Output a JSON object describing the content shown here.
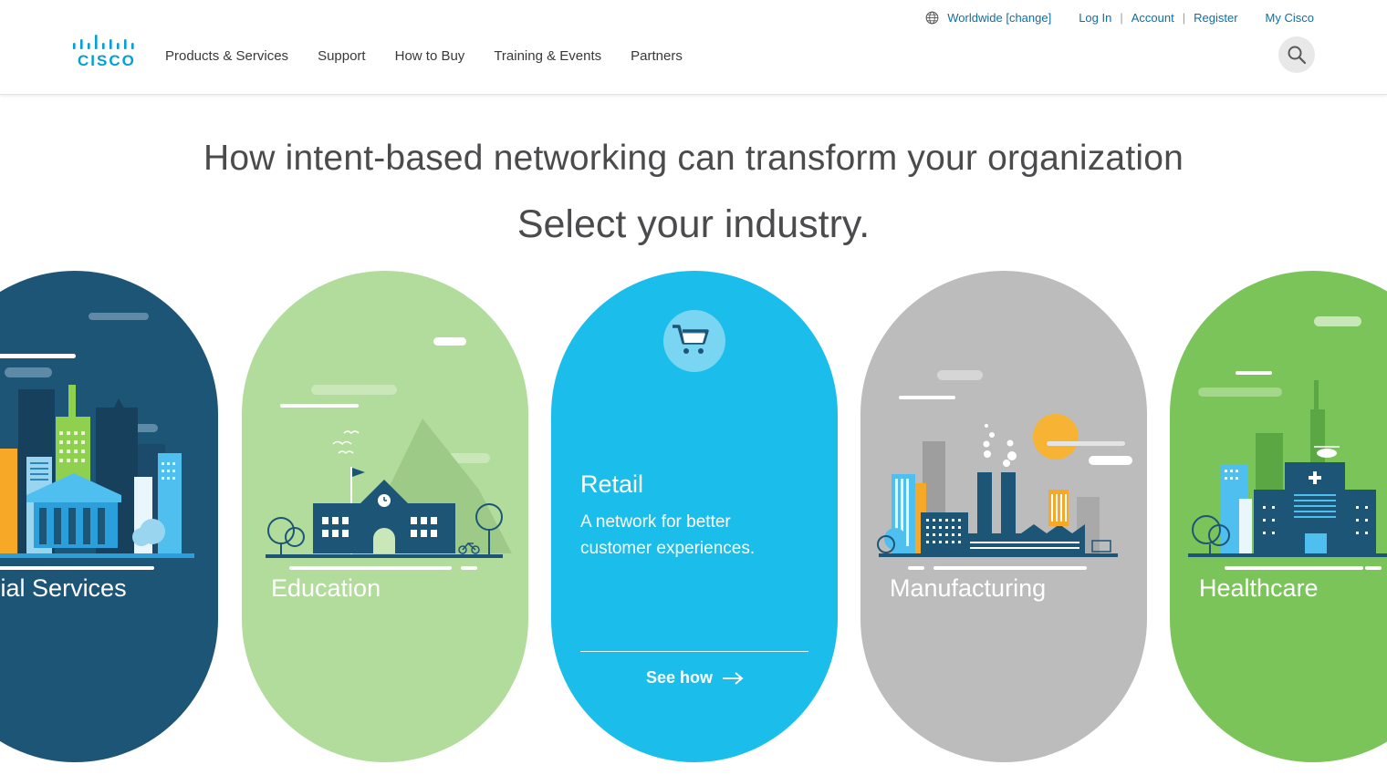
{
  "brand": {
    "logo_text": "CISCO"
  },
  "utility_nav": {
    "worldwide": "Worldwide [change]",
    "login": "Log In",
    "account": "Account",
    "register": "Register",
    "my_cisco": "My Cisco"
  },
  "main_nav": [
    "Products & Services",
    "Support",
    "How to Buy",
    "Training & Events",
    "Partners"
  ],
  "headline": "How intent-based networking can transform your organization",
  "subheadline": "Select your industry.",
  "cards": [
    {
      "label": "ancial Services",
      "color": "#1d5577"
    },
    {
      "label": "Education",
      "color": "#b2dc9b"
    },
    {
      "label": "Retail",
      "description": "A network for better customer experiences.",
      "cta": "See how",
      "color": "#1bbdeb"
    },
    {
      "label": "Manufacturing",
      "color": "#bcbcbc"
    },
    {
      "label": "Healthcare",
      "color": "#7bc45a"
    }
  ],
  "icons": {
    "search": "search-icon",
    "globe": "globe-icon",
    "cart": "cart-icon",
    "arrow": "arrow-right-icon"
  }
}
